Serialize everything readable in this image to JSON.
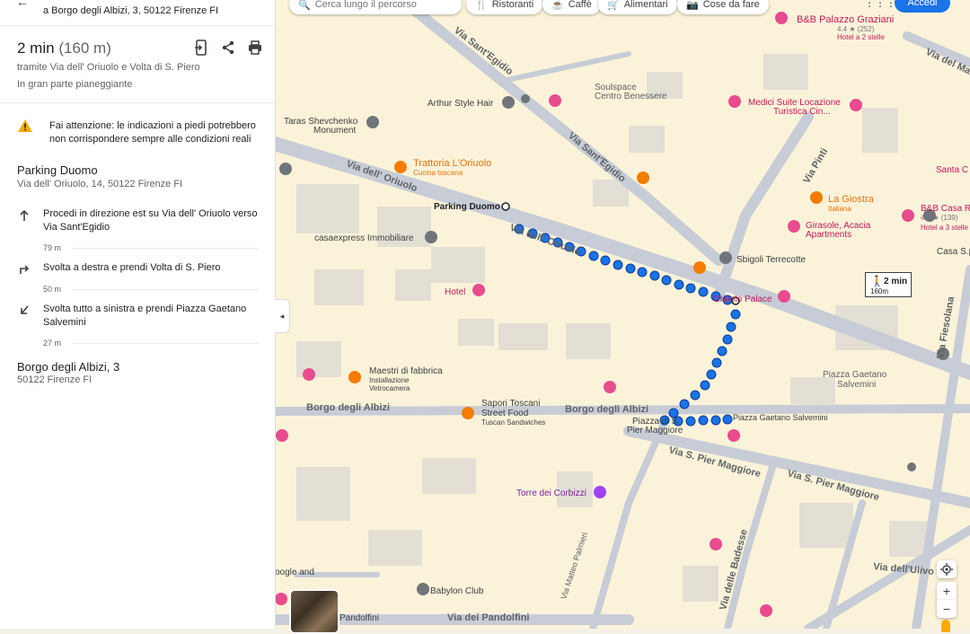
{
  "panel": {
    "destination_top": "a Borgo degli Albizi, 3, 50122 Firenze FI",
    "duration": "2 min",
    "distance": "(160 m)",
    "via": "tramite Via dell' Oriuolo e Volta di S. Piero",
    "terrain": "In gran parte pianeggiante",
    "warning": "Fai attenzione: le indicazioni a piedi potrebbero non corrispondere sempre alle condizioni reali",
    "start": {
      "name": "Parking Duomo",
      "address": "Via dell' Oriuolo, 14, 50122 Firenze FI"
    },
    "steps": [
      {
        "icon": "arrow-up-icon",
        "text": "Procedi in direzione est su Via dell' Oriuolo verso Via Sant'Egidio",
        "distance": "79 m"
      },
      {
        "icon": "turn-right-icon",
        "text": "Svolta a destra e prendi Volta di S. Piero",
        "distance": "50 m"
      },
      {
        "icon": "sharp-left-icon",
        "text": "Svolta tutto a sinistra e prendi Piazza Gaetano Salvemini",
        "distance": "27 m"
      }
    ],
    "end": {
      "name": "Borgo degli Albizi, 3",
      "address": "50122 Firenze FI"
    }
  },
  "toolbar": {
    "search_placeholder": "Cerca lungo il percorso",
    "chips": [
      "Ristoranti",
      "Caffè",
      "Alimentari",
      "Cose da fare"
    ],
    "sign_in": "Accedi"
  },
  "map": {
    "streets": [
      "Via Sant'Egidio",
      "Via Sant'Egidio",
      "Via dell' Oriuolo",
      "Via dell' Oriuolo",
      "Borgo degli Albizi",
      "Borgo degli Albizi",
      "Via S. Pier Maggiore",
      "Via S. Pier Maggiore",
      "Via Pinti",
      "Via del Mandorlo",
      "Via dei Pandolfini",
      "Via dell'Ulivo",
      "Via delle Badesse",
      "Via Matteo Palmieri",
      "Via Fiesolana",
      "Piazza Gaetano Salvemini"
    ],
    "places": {
      "palazzo": "B&B Palazzo Graziani",
      "palazzo_rating": "4.4 ★ (252)",
      "palazzo_sub": "Hotel a 2 stelle",
      "soulspace": "Soulspace",
      "soulspace_sub": "Centro Benessere",
      "arthur": "Arthur Style Hair",
      "medici": "Medici Suite Locazione",
      "medici_sub": "Turistica Cin...",
      "taras": "Taras Shevchenko",
      "taras_sub": "Monument",
      "trattoria": "Trattoria L'Oriuolo",
      "trattoria_sub": "Cucina toscana",
      "parking": "Parking Duomo",
      "giostra": "La Giostra",
      "giostra_sub": "Italiana",
      "bbcasa": "B&B Casa R",
      "bbcasa_rating": "4.4 ★ (139)",
      "bbcasa_sub": "Hotel a 3 stelle",
      "girasole": "Girasole, Acacia",
      "girasole_sub": "Apartments",
      "casaexpress": "casaexpress Immobiliare",
      "sbigoli": "Sbigoli Terrecotte",
      "casaspa": "Casa S.p.A",
      "hotel": "Hotel",
      "oriuolo_palace": "Oriuolo Palace",
      "maestri": "Maestri di fabbrica",
      "maestri_sub": "Installazione",
      "maestri_sub2": "Vetrocamera",
      "sapori": "Sapori Toscani",
      "sapori_sub": "Street Food",
      "sapori_sub2": "Tuscan Sandwiches",
      "piazza_sp": "Piazza di S.",
      "piazza_sp2": "Pier Maggiore",
      "salvemini": "Piazza Gaetano",
      "salvemini2": "Salvemini",
      "torre": "Torre dei Corbizzi",
      "babylon": "Babylon Club",
      "santa": "Santa C",
      "pandolfini_left": "Pandolfini",
      "ogle": "oogle and"
    },
    "route_duration": "2 min",
    "route_distance": "160m"
  },
  "colors": {
    "route": "#1a73e8",
    "route_stroke": "#0d3b94",
    "road": "#aab4c4",
    "building": "#e3dfd5",
    "block": "#fbf3d9",
    "poi_pink": "#e94b8f",
    "poi_orange": "#f57c00"
  }
}
